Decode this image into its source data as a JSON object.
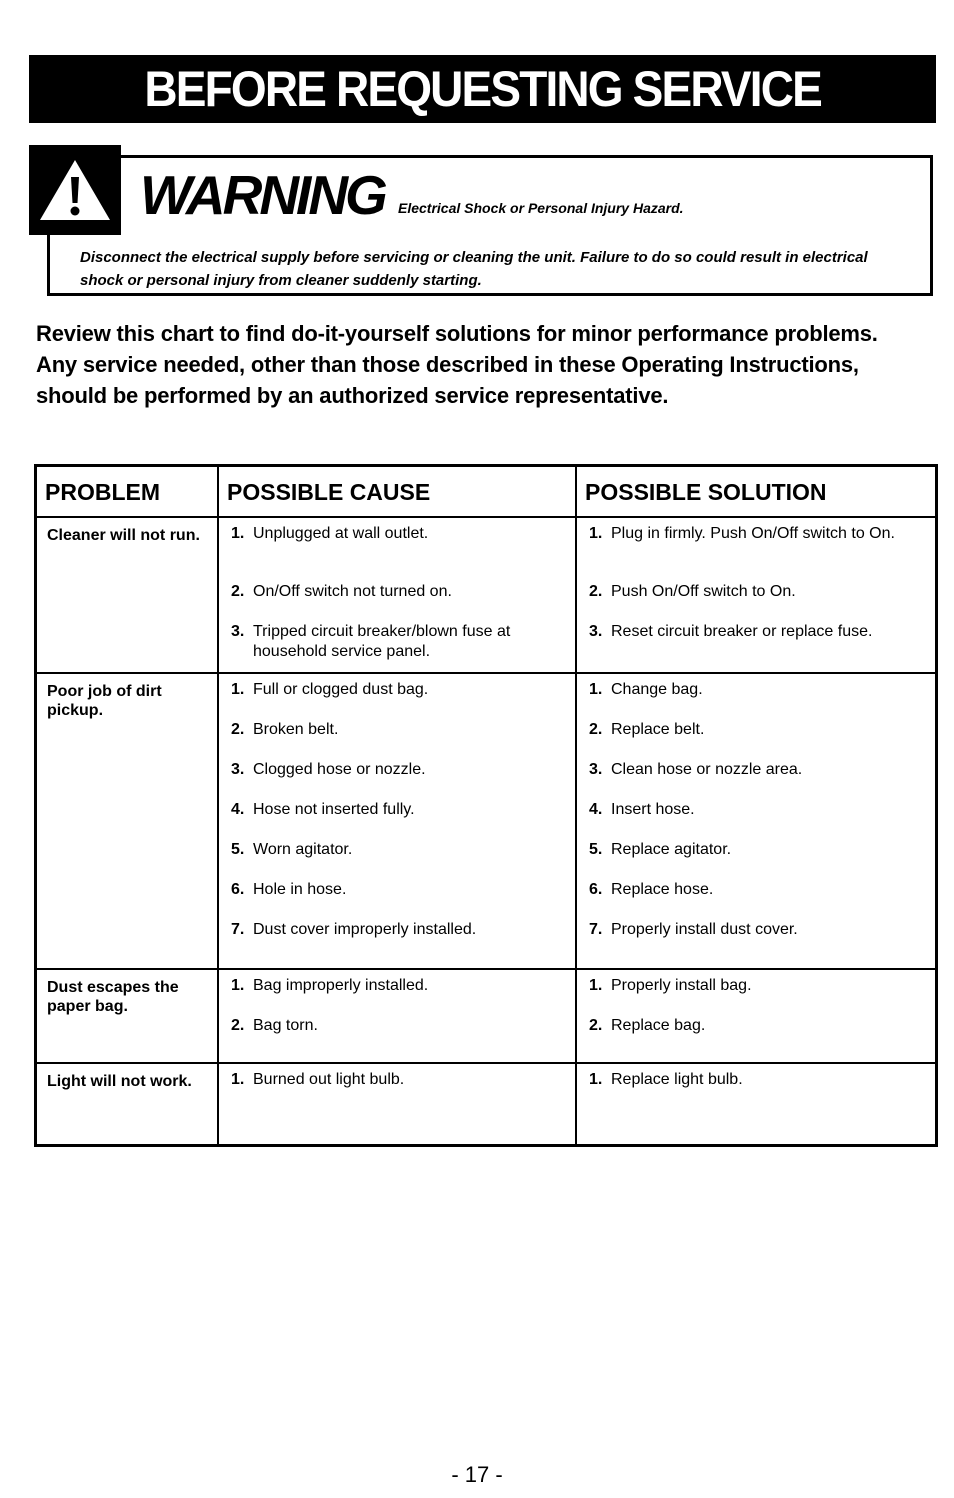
{
  "header": {
    "title": "BEFORE REQUESTING SERVICE"
  },
  "warning": {
    "icon": "warning-triangle-icon",
    "title": "WARNING",
    "subtitle": "Electrical Shock or Personal Injury Hazard.",
    "body": "Disconnect the electrical supply before servicing or cleaning the unit.  Failure to do so could result in electrical shock or personal injury from cleaner suddenly starting."
  },
  "intro": "Review this chart to find do-it-yourself solutions for minor performance problems.  Any service needed, other than those described in these Operating Instructions, should be performed by an authorized service representative.",
  "table": {
    "headers": [
      "PROBLEM",
      "POSSIBLE CAUSE",
      "POSSIBLE SOLUTION"
    ],
    "rows": [
      {
        "problem": "Cleaner will not run.",
        "causes": [
          {
            "num": "1.",
            "text": "Unplugged at wall outlet."
          },
          {
            "num": "2.",
            "text": "On/Off switch not turned on."
          },
          {
            "num": "3.",
            "text": "Tripped circuit breaker/blown fuse at household service panel."
          }
        ],
        "solutions": [
          {
            "num": "1.",
            "text": "Plug in firmly.  Push On/Off switch to On."
          },
          {
            "num": "2.",
            "text": "Push On/Off switch to On."
          },
          {
            "num": "3.",
            "text": "Reset circuit breaker or replace fuse."
          }
        ]
      },
      {
        "problem": "Poor job of dirt pickup.",
        "causes": [
          {
            "num": "1.",
            "text": "Full or clogged dust bag."
          },
          {
            "num": "2.",
            "text": "Broken belt."
          },
          {
            "num": "3.",
            "text": "Clogged hose or nozzle."
          },
          {
            "num": "4.",
            "text": "Hose not inserted fully."
          },
          {
            "num": "5.",
            "text": "Worn agitator."
          },
          {
            "num": "6.",
            "text": "Hole in hose."
          },
          {
            "num": "7.",
            "text": "Dust cover improperly installed."
          }
        ],
        "solutions": [
          {
            "num": "1.",
            "text": "Change bag."
          },
          {
            "num": "2.",
            "text": "Replace belt."
          },
          {
            "num": "3.",
            "text": "Clean hose or nozzle area."
          },
          {
            "num": "4.",
            "text": "Insert hose."
          },
          {
            "num": "5.",
            "text": "Replace agitator."
          },
          {
            "num": "6.",
            "text": "Replace hose."
          },
          {
            "num": "7.",
            "text": "Properly install dust cover."
          }
        ]
      },
      {
        "problem": "Dust escapes the paper bag.",
        "causes": [
          {
            "num": "1.",
            "text": "Bag improperly installed."
          },
          {
            "num": "2.",
            "text": "Bag torn."
          }
        ],
        "solutions": [
          {
            "num": "1.",
            "text": "Properly install bag."
          },
          {
            "num": "2.",
            "text": "Replace bag."
          }
        ]
      },
      {
        "problem": "Light will not work.",
        "causes": [
          {
            "num": "1.",
            "text": "Burned out light bulb."
          }
        ],
        "solutions": [
          {
            "num": "1.",
            "text": "Replace light bulb."
          }
        ]
      }
    ]
  },
  "footer": {
    "page_number": "- 17 -"
  }
}
